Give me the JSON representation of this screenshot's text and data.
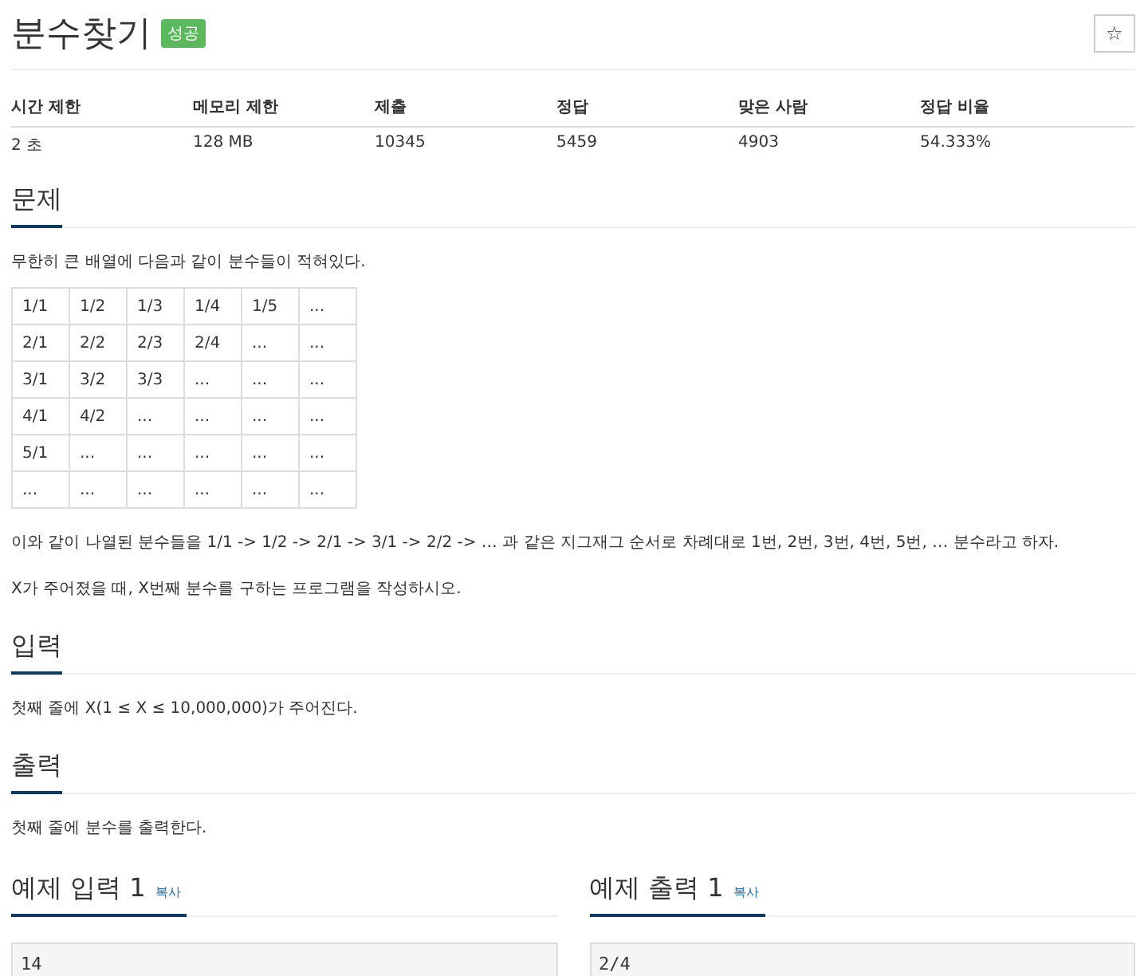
{
  "title": "분수찾기",
  "badge": "성공",
  "star_button": "☆",
  "stats": {
    "columns": [
      "시간 제한",
      "메모리 제한",
      "제출",
      "정답",
      "맞은 사람",
      "정답 비율"
    ],
    "values": [
      "2 초",
      "128 MB",
      "10345",
      "5459",
      "4903",
      "54.333%"
    ]
  },
  "sections": [
    {
      "heading": "문제",
      "blocks": [
        {
          "kind": "paragraph",
          "text": "무한히 큰 배열에 다음과 같이 분수들이 적혀있다."
        },
        {
          "kind": "table",
          "rows": [
            [
              "1/1",
              "1/2",
              "1/3",
              "1/4",
              "1/5",
              "..."
            ],
            [
              "2/1",
              "2/2",
              "2/3",
              "2/4",
              "...",
              "..."
            ],
            [
              "3/1",
              "3/2",
              "3/3",
              "...",
              "...",
              "..."
            ],
            [
              "4/1",
              "4/2",
              "...",
              "...",
              "...",
              "..."
            ],
            [
              "5/1",
              "...",
              "...",
              "...",
              "...",
              "..."
            ],
            [
              "...",
              "...",
              "...",
              "...",
              "...",
              "..."
            ]
          ]
        },
        {
          "kind": "paragraph",
          "text": "이와 같이 나열된 분수들을 1/1 -> 1/2 -> 2/1 -> 3/1 -> 2/2 -> … 과 같은 지그재그 순서로 차례대로 1번, 2번, 3번, 4번, 5번, … 분수라고 하자."
        },
        {
          "kind": "paragraph",
          "text": "X가 주어졌을 때, X번째 분수를 구하는 프로그램을 작성하시오."
        }
      ]
    },
    {
      "heading": "입력",
      "blocks": [
        {
          "kind": "paragraph",
          "text": "첫째 줄에 X(1 ≤ X ≤ 10,000,000)가 주어진다."
        }
      ]
    },
    {
      "heading": "출력",
      "blocks": [
        {
          "kind": "paragraph",
          "text": "첫째 줄에 분수를 출력한다."
        }
      ]
    }
  ],
  "examples": [
    {
      "heading": "예제 입력 1",
      "copy": "복사",
      "content": "14"
    },
    {
      "heading": "예제 출력 1",
      "copy": "복사",
      "content": "2/4"
    }
  ]
}
